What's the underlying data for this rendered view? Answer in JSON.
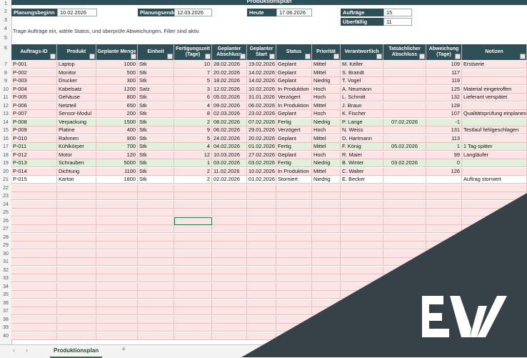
{
  "title": "Produktionsplan",
  "params": {
    "planungsbeginn_label": "Planungsbeginn",
    "planungsbeginn": "10.02.2026",
    "planungsende_label": "Planungsende",
    "planungsende": "12.03.2026",
    "heute_label": "Heute",
    "heute": "17.06.2026",
    "auftraege_label": "Aufträge",
    "auftraege": "15",
    "ueberfaellig_label": "Überfällig",
    "ueberfaellig": "11"
  },
  "hint": "Trage Aufträge ein, wähle Status, und überprüfe Abweichungen. Filter sind aktiv.",
  "headers": [
    "Auftrags-ID",
    "Produkt",
    "Geplante Menge",
    "Einheit",
    "Fertigungszeit (Tage)",
    "Geplanter Abschluss",
    "Geplanter Start",
    "Status",
    "Priorität",
    "Verantwortlich",
    "Tatsächlicher Abschluss",
    "Abweichung (Tage)",
    "Notizen"
  ],
  "rows": [
    [
      "P-001",
      "Laptop",
      "1000",
      "Stk",
      "10",
      "28.02.2026",
      "19.02.2026",
      "Geplant",
      "Mittel",
      "M. Keller",
      "",
      "109",
      "Erstserie"
    ],
    [
      "P-002",
      "Monitor",
      "500",
      "Stk",
      "7",
      "20.02.2026",
      "14.02.2026",
      "Geplant",
      "Mittel",
      "S. Brandt",
      "",
      "117",
      ""
    ],
    [
      "P-003",
      "Drucker",
      "300",
      "Stk",
      "5",
      "18.02.2026",
      "14.02.2026",
      "Geplant",
      "Niedrig",
      "T. Vogel",
      "",
      "119",
      ""
    ],
    [
      "P-004",
      "Kabelsatz",
      "1200",
      "Satz",
      "3",
      "12.02.2026",
      "10.02.2026",
      "In Produktion",
      "Hoch",
      "A. Neumann",
      "",
      "125",
      "Material eingetroffen"
    ],
    [
      "P-005",
      "Gehäuse",
      "800",
      "Stk",
      "6",
      "05.02.2026",
      "31.01.2026",
      "Verzögert",
      "Hoch",
      "L. Schmitt",
      "",
      "132",
      "Lieferant verspätet"
    ],
    [
      "P-006",
      "Netzteil",
      "650",
      "Stk",
      "4",
      "09.02.2026",
      "06.02.2026",
      "In Produktion",
      "Mittel",
      "J. Braun",
      "",
      "128",
      ""
    ],
    [
      "P-007",
      "Sensor-Modul",
      "200",
      "Stk",
      "8",
      "02.03.2026",
      "23.02.2026",
      "Geplant",
      "Hoch",
      "K. Fischer",
      "",
      "107",
      "Qualitätsprüfung einplanen"
    ],
    [
      "P-008",
      "Verpackung",
      "1500",
      "Stk",
      "2",
      "08.02.2026",
      "07.02.2026",
      "Fertig",
      "Niedrig",
      "P. Lange",
      "07.02.2026",
      "-1",
      ""
    ],
    [
      "P-009",
      "Platine",
      "400",
      "Stk",
      "9",
      "06.02.2026",
      "29.01.2026",
      "Verzögert",
      "Hoch",
      "N. Weiss",
      "",
      "131",
      "Testlauf fehlgeschlagen"
    ],
    [
      "P-010",
      "Rahmen",
      "900",
      "Stk",
      "5",
      "24.02.2026",
      "20.02.2026",
      "Geplant",
      "Mittel",
      "D. Hartmann",
      "",
      "113",
      ""
    ],
    [
      "P-011",
      "Kühlkörper",
      "700",
      "Stk",
      "4",
      "04.02.2026",
      "01.02.2026",
      "Fertig",
      "Mittel",
      "F. König",
      "05.02.2026",
      "1",
      "1 Tag später"
    ],
    [
      "P-012",
      "Motor",
      "120",
      "Stk",
      "12",
      "10.03.2026",
      "27.02.2026",
      "Geplant",
      "Hoch",
      "R. Maier",
      "",
      "99",
      "Langläufer"
    ],
    [
      "P-013",
      "Schrauben",
      "5000",
      "Stk",
      "1",
      "03.02.2026",
      "03.02.2026",
      "Fertig",
      "Niedrig",
      "B. Winter",
      "03.02.2026",
      "0",
      ""
    ],
    [
      "P-014",
      "Dichtung",
      "1100",
      "Stk",
      "2",
      "11.02.2026",
      "10.02.2026",
      "In Produktion",
      "Mittel",
      "C. Walter",
      "",
      "126",
      ""
    ],
    [
      "P-015",
      "Karton",
      "1800",
      "Stk",
      "2",
      "02.02.2026",
      "01.02.2026",
      "Storniert",
      "Niedrig",
      "E. Becker",
      "",
      "",
      "Auftrag storniert"
    ]
  ],
  "row_status": [
    "red",
    "red",
    "red",
    "red",
    "red",
    "red",
    "red",
    "green",
    "red",
    "red",
    "green",
    "red",
    "green",
    "red",
    "white"
  ],
  "row_numbers": [
    "1",
    "2",
    "3",
    "4",
    "5",
    "6",
    "7",
    "8",
    "9",
    "10",
    "11",
    "12",
    "13",
    "14",
    "15",
    "16",
    "17",
    "18",
    "19",
    "20",
    "21",
    "22",
    "23",
    "24",
    "25",
    "26",
    "27",
    "28",
    "29",
    "30",
    "31",
    "32",
    "33",
    "34",
    "35",
    "36",
    "37",
    "38",
    "39",
    "40"
  ],
  "sheet_tab": "Produktionsplan",
  "add_sheet": "+",
  "nav_prev": "‹",
  "nav_next": "›",
  "colors": {
    "header": "#2f4f57",
    "red_row": "#fce4e4",
    "green_row": "#e2efda",
    "logo_bg": "#364248"
  },
  "logo_icon": "ew-logo"
}
